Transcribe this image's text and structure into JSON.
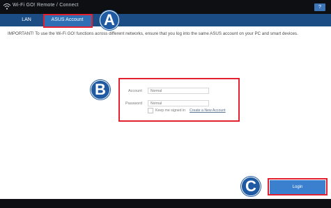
{
  "window": {
    "title": "Wi-Fi GO! Remote / Connect",
    "help_label": "?"
  },
  "tabs": [
    {
      "label": "LAN",
      "active": false
    },
    {
      "label": "ASUS Account",
      "active": true
    }
  ],
  "notice": "IMPORTANT! To use the Wi-Fi GO! functions across different networks, ensure that you log into the same ASUS account on your PC and smart devices.",
  "form": {
    "account_label": "Account",
    "account_placeholder": "Normal",
    "password_label": "Password",
    "password_placeholder": "Normal",
    "keep_signed_in": "Keep me signed in",
    "keep_signed_in_checked": false,
    "create_account_link": "Create a New Account"
  },
  "login_button": "Login",
  "callouts": [
    "A",
    "B",
    "C"
  ],
  "colors": {
    "accent": "#2e6fb5",
    "tabbar": "#1b4d84",
    "callout": "#1f5aa2",
    "highlight": "#e22030",
    "login": "#3a80cf"
  }
}
